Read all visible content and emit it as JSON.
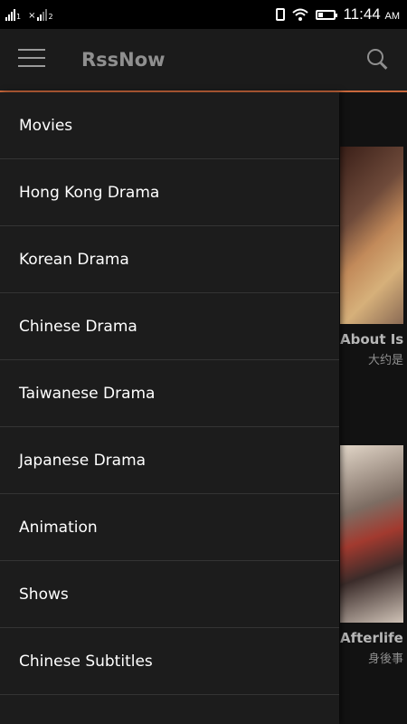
{
  "status_bar": {
    "sim1": "1",
    "sim2": "2",
    "time": "11:44",
    "ampm": "AM"
  },
  "app_bar": {
    "title": "RssNow"
  },
  "drawer": {
    "items": [
      {
        "label": "Movies"
      },
      {
        "label": "Hong Kong Drama"
      },
      {
        "label": "Korean Drama"
      },
      {
        "label": "Chinese Drama"
      },
      {
        "label": "Taiwanese Drama"
      },
      {
        "label": "Japanese Drama"
      },
      {
        "label": "Animation"
      },
      {
        "label": "Shows"
      },
      {
        "label": "Chinese Subtitles"
      }
    ]
  },
  "content": {
    "cards": [
      {
        "title": "About Is",
        "subtitle": "大约是"
      },
      {
        "title": "Afterlife",
        "subtitle": "身後事"
      }
    ]
  }
}
